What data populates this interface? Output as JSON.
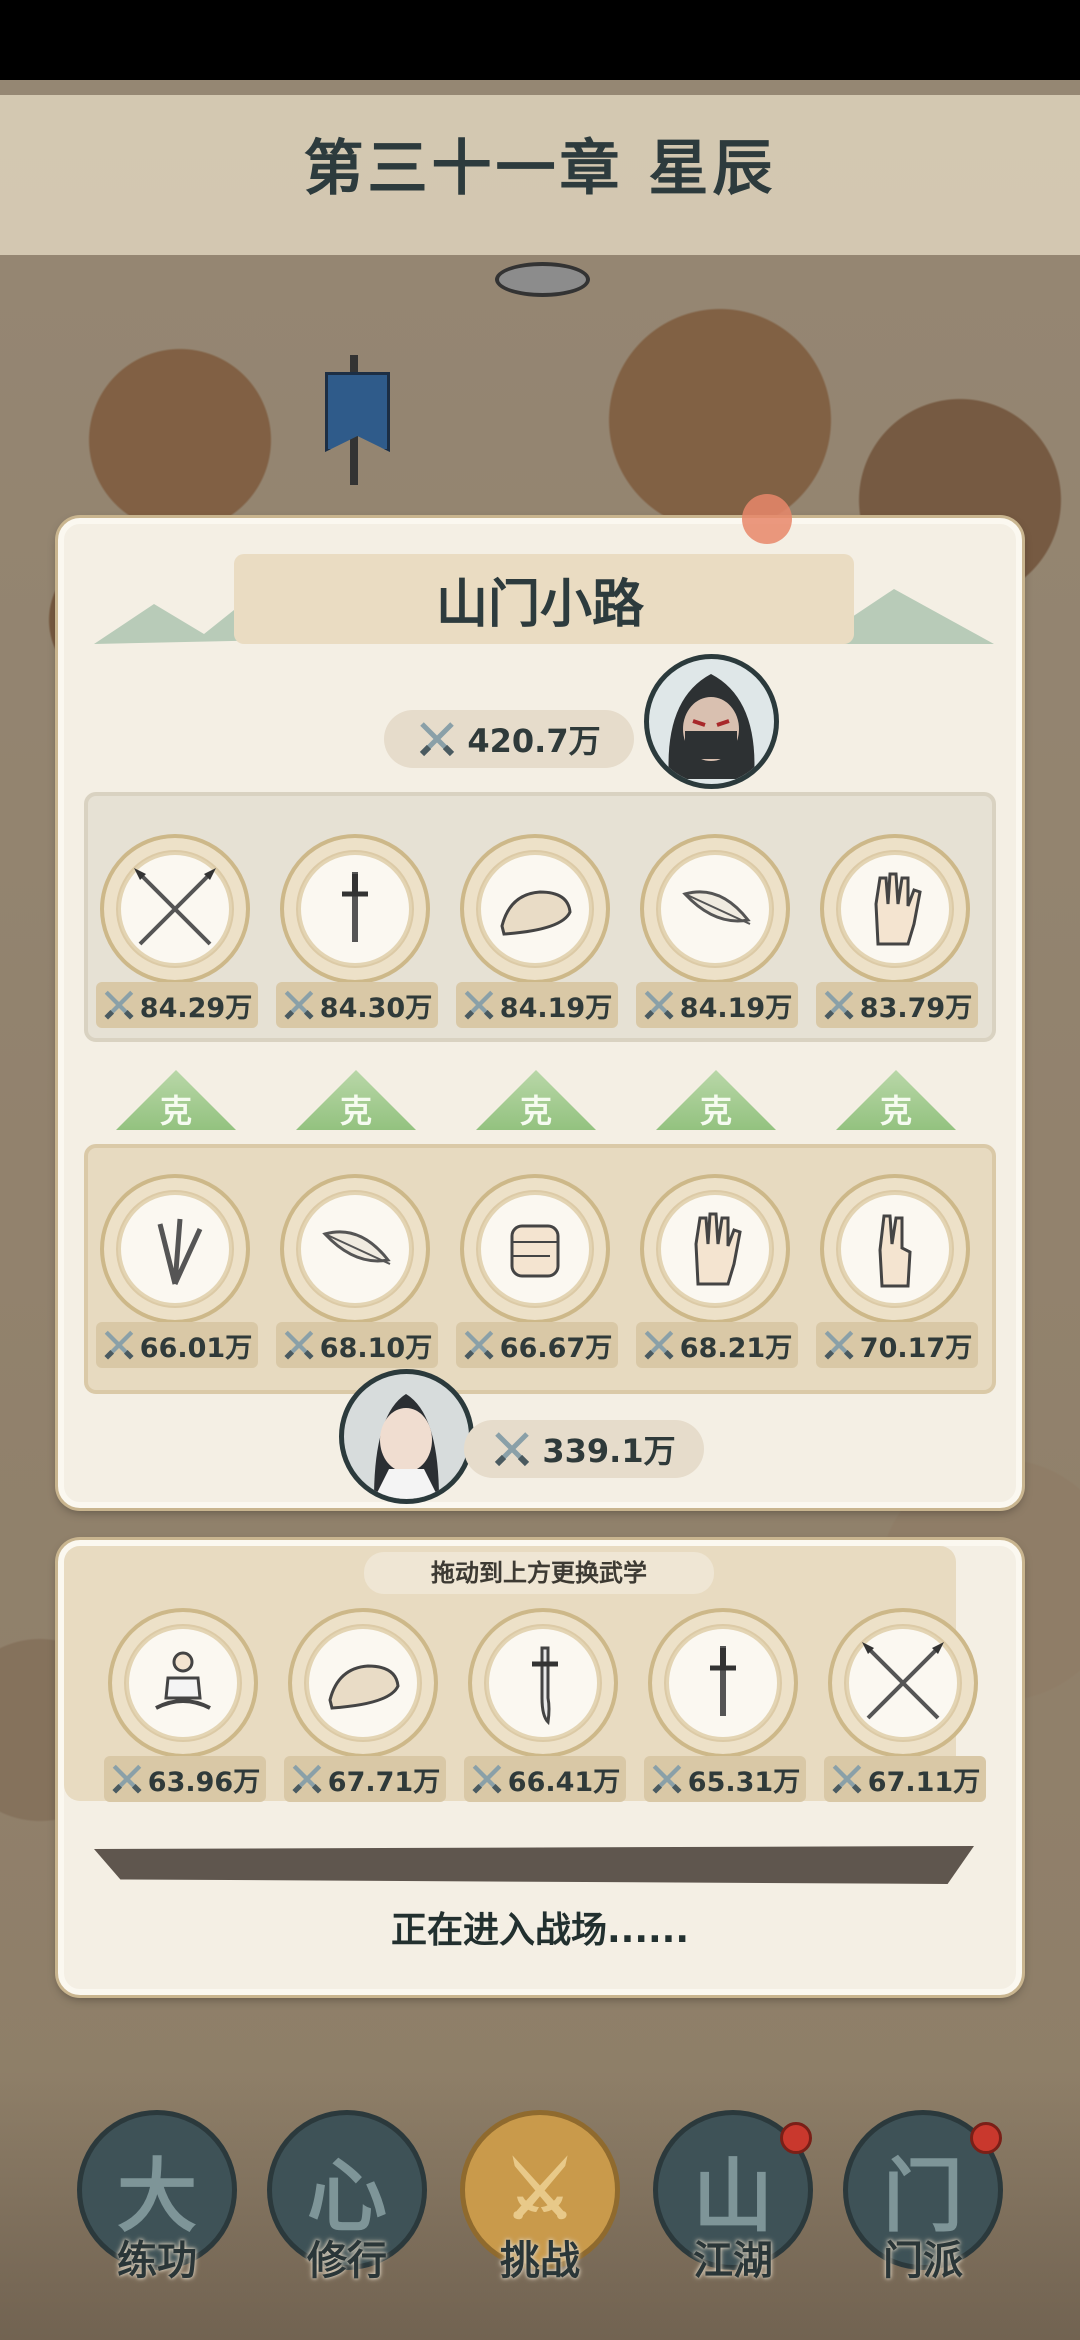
{
  "chapter": {
    "title": "第三十一章 星辰"
  },
  "stage": {
    "title": "山门小路",
    "enemy_power": "420.7万",
    "player_power": "339.1万"
  },
  "enemy_skills": [
    {
      "icon": "crossed-spears-icon",
      "value": "84.29万"
    },
    {
      "icon": "sword-icon",
      "value": "84.30万"
    },
    {
      "icon": "shoe-icon",
      "value": "84.19万"
    },
    {
      "icon": "feather-icon",
      "value": "84.19万"
    },
    {
      "icon": "open-palm-icon",
      "value": "83.79万"
    }
  ],
  "counters": [
    "克",
    "克",
    "克",
    "克",
    "克"
  ],
  "player_skills": [
    {
      "icon": "throwing-knives-icon",
      "value": "66.01万"
    },
    {
      "icon": "feather-icon",
      "value": "68.10万"
    },
    {
      "icon": "fist-icon",
      "value": "66.67万"
    },
    {
      "icon": "open-palm-icon",
      "value": "68.21万"
    },
    {
      "icon": "two-finger-icon",
      "value": "70.17万"
    }
  ],
  "inventory": {
    "hint": "拖动到上方更换武学",
    "skills": [
      {
        "icon": "meditation-icon",
        "value": "63.96万"
      },
      {
        "icon": "shoe-icon",
        "value": "67.71万"
      },
      {
        "icon": "saber-icon",
        "value": "66.41万"
      },
      {
        "icon": "sword-icon",
        "value": "65.31万"
      },
      {
        "icon": "crossed-spears-icon",
        "value": "67.11万"
      }
    ]
  },
  "loading": {
    "text": "正在进入战场......",
    "progress": 1.0
  },
  "nav": [
    {
      "label": "练功",
      "glyph": "大",
      "badge": false,
      "active": false
    },
    {
      "label": "修行",
      "glyph": "心",
      "badge": false,
      "active": false
    },
    {
      "label": "挑战",
      "glyph": "⚔",
      "badge": false,
      "active": true
    },
    {
      "label": "江湖",
      "glyph": "山",
      "badge": true,
      "active": false
    },
    {
      "label": "门派",
      "glyph": "门",
      "badge": true,
      "active": false
    }
  ],
  "colors": {
    "panel": "#f4efe4",
    "counter_green": "#93c27f",
    "badge_red": "#c9382d",
    "active_gold": "#c99a4b"
  }
}
